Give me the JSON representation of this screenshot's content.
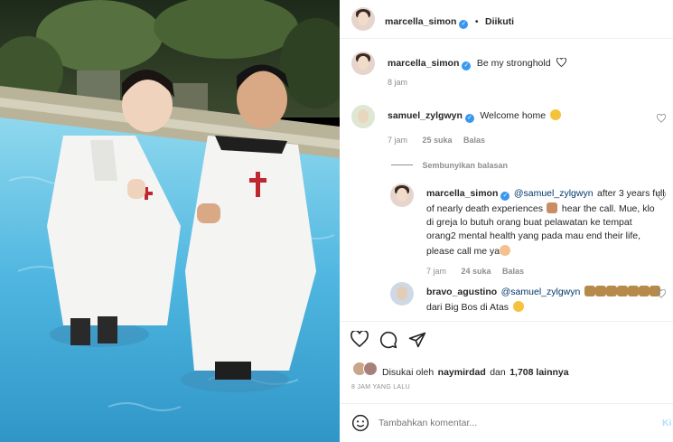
{
  "header": {
    "username": "marcella_simon",
    "separator": "•",
    "follow_status": "Diikuti"
  },
  "caption": {
    "username": "marcella_simon",
    "text": "Be my stronghold",
    "time": "8 jam"
  },
  "comments": [
    {
      "username": "samuel_zylgwyn",
      "text": "Welcome home",
      "time": "7 jam",
      "likes": "25 suka",
      "reply_label": "Balas"
    }
  ],
  "hide_replies_label": "Sembunyikan balasan",
  "replies": [
    {
      "username": "marcella_simon",
      "mention": "@samuel_zylgwyn",
      "line1_rest": "after 3 years full",
      "line2": "of nearly death experiences",
      "line2_rest": "hear the call. Mue, klo",
      "line3": "di greja lo butuh orang buat pelawatan ke tempat",
      "line4": "orang2 mental health yang pada mau end their life,",
      "line5": "please call me ya",
      "time": "7 jam",
      "likes": "24 suka",
      "reply_label": "Balas"
    },
    {
      "username": "bravo_agustino",
      "mention": "@samuel_zylgwyn",
      "line2": "dari Big Bos di Atas"
    }
  ],
  "likes_summary": {
    "prefix": "Disukai oleh",
    "user": "naymirdad",
    "joiner": "dan",
    "count": "1,708 lainnya"
  },
  "post_time": "8 JAM YANG LALU",
  "comment_input": {
    "placeholder": "Tambahkan komentar...",
    "post_label": "Ki"
  },
  "colors": {
    "verified": "#3897f0",
    "mention": "#00376b",
    "pool_water": "#5fc3e8",
    "robe": "#f4f4f2",
    "cross": "#c0262d"
  }
}
